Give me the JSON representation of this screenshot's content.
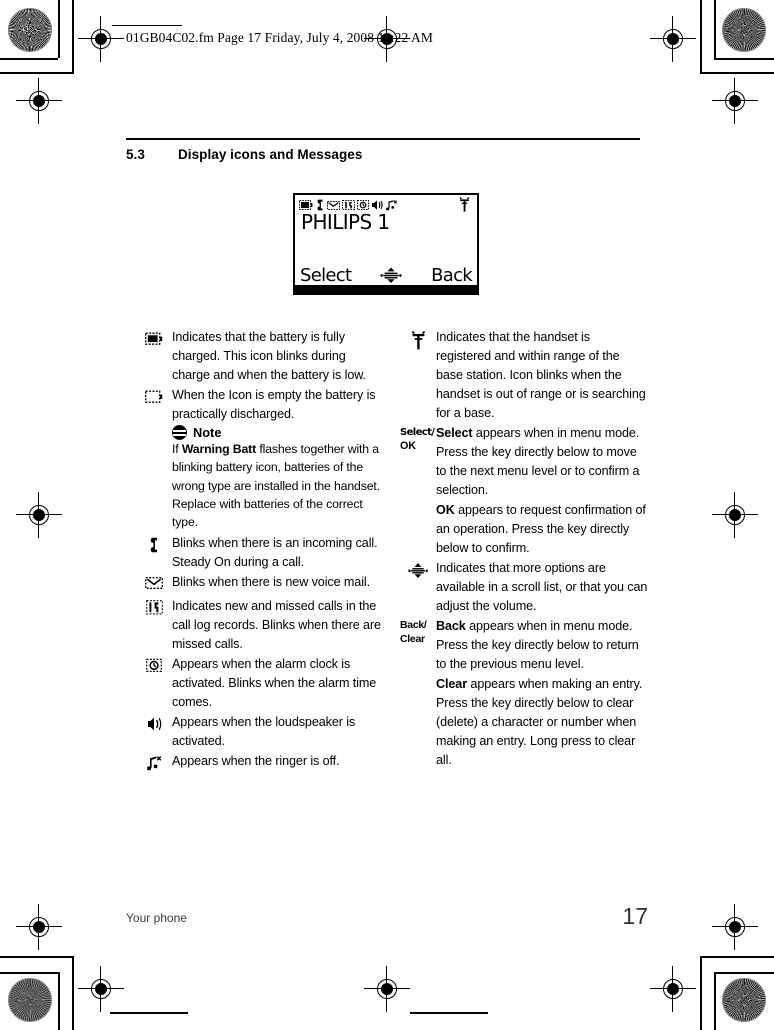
{
  "fm_header": "01GB04C02.fm  Page 17  Friday, July 4, 2008  11:22 AM",
  "section": {
    "number": "5.3",
    "title": "Display icons and Messages"
  },
  "lcd": {
    "title": "PHILIPS 1",
    "softkey_left": "Select",
    "softkey_right": "Back",
    "scroll_icon": "scroll-updown-icon",
    "status_icons": [
      "battery-full-icon",
      "call-in-progress-icon",
      "voicemail-icon",
      "missed-call-icon",
      "alarm-clock-icon",
      "loudspeaker-icon",
      "ringer-off-icon"
    ],
    "antenna_icon": "antenna-signal-icon"
  },
  "left_column": [
    {
      "icon": "battery-full-icon",
      "text": "Indicates that the battery is fully charged. This icon blinks during charge and when the battery is low."
    },
    {
      "icon": "battery-empty-icon",
      "text": "When the Icon is empty the battery is practically discharged."
    },
    {
      "icon": "call-in-progress-icon",
      "text": "Blinks when there is an incoming call. Steady On during a call."
    },
    {
      "icon": "voicemail-icon",
      "text": "Blinks when there is new voice mail."
    },
    {
      "icon": "missed-call-icon",
      "text": "Indicates new and missed calls in the call log records. Blinks when there are missed calls."
    },
    {
      "icon": "alarm-clock-icon",
      "text": "Appears when the alarm clock is activated. Blinks when the alarm time comes."
    },
    {
      "icon": "loudspeaker-icon",
      "text": "Appears when the loudspeaker is activated."
    },
    {
      "icon": "ringer-off-icon",
      "text": "Appears when the ringer is off."
    }
  ],
  "note": {
    "icon": "note-icon",
    "label": "Note",
    "lead": "If ",
    "bold_term": "Warning Batt",
    "body": " flashes together with a blinking battery icon, batteries of the wrong type are installed in the handset. Replace with batteries of the correct type."
  },
  "right_column": [
    {
      "icon": "antenna-signal-icon",
      "label": "",
      "text": "Indicates that the handset is registered and within range of the base station. Icon blinks when the handset is out of range or is searching for a base."
    },
    {
      "icon": "",
      "label_line1": "Select/",
      "label_line2": "OK",
      "bold_term": "Select",
      "text": " appears when in menu mode. Press the key directly below to move to the next menu level or to confirm a selection."
    },
    {
      "icon": "",
      "label": "",
      "bold_term": "OK",
      "text": " appears to request confirmation of an operation. Press the key directly below to confirm."
    },
    {
      "icon": "scroll-updown-icon",
      "label": "",
      "text": "Indicates that more options are available in a scroll list, or that you can adjust the volume."
    },
    {
      "icon": "",
      "label_line1": "Back/",
      "label_line2": "Clear",
      "bold_term": "Back",
      "text": " appears when in menu mode. Press the key directly below to return to the previous menu level."
    },
    {
      "icon": "",
      "label": "",
      "bold_term": "Clear",
      "text": " appears when making an entry. Press the key directly below to clear (delete) a character or number when making an entry. Long press to clear all."
    }
  ],
  "footer": {
    "chapter": "Your phone",
    "page_number": "17"
  }
}
